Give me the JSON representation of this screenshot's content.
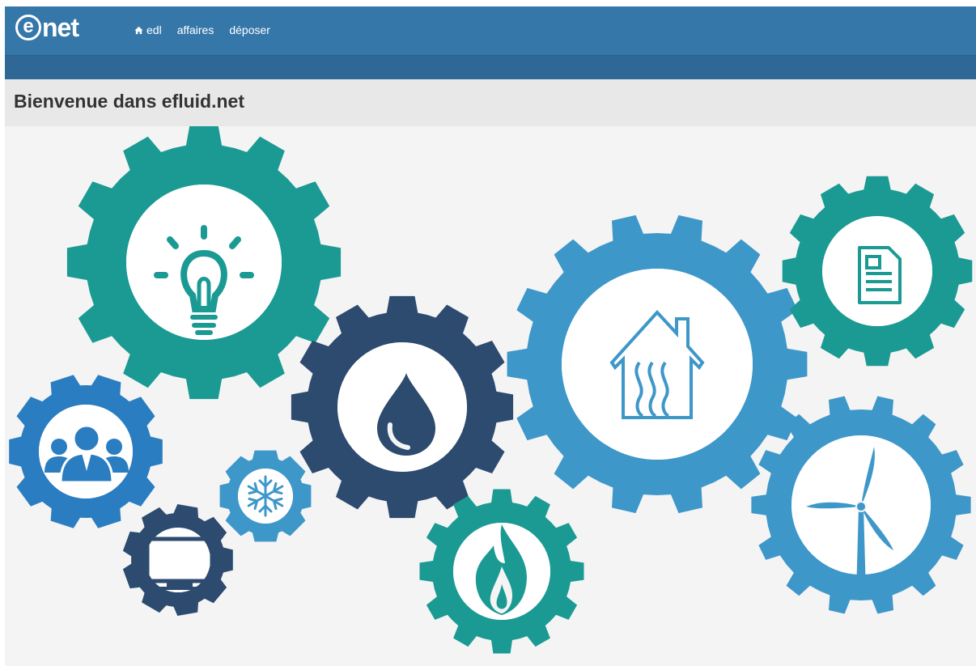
{
  "app": {
    "logo_letter": "e",
    "logo_word": "net"
  },
  "nav": {
    "items": [
      {
        "label": "edl",
        "icon": "home-icon"
      },
      {
        "label": "affaires"
      },
      {
        "label": "déposer"
      }
    ]
  },
  "page": {
    "title": "Bienvenue dans efluid.net"
  },
  "illustration": {
    "gears": [
      {
        "name": "lightbulb-gear",
        "icon": "lightbulb-icon",
        "color": "#1a9a93"
      },
      {
        "name": "water-drop-gear",
        "icon": "water-drop-icon",
        "color": "#2d4a6f"
      },
      {
        "name": "house-heating-gear",
        "icon": "house-heating-icon",
        "color": "#3e97c9"
      },
      {
        "name": "document-gear",
        "icon": "document-icon",
        "color": "#1a9a93"
      },
      {
        "name": "people-gear",
        "icon": "people-icon",
        "color": "#2a7dc0"
      },
      {
        "name": "snowflake-gear",
        "icon": "snowflake-icon",
        "color": "#3e97c9"
      },
      {
        "name": "monitor-gear",
        "icon": "monitor-icon",
        "color": "#2d4a6f"
      },
      {
        "name": "flame-gear",
        "icon": "flame-icon",
        "color": "#1a9a93"
      },
      {
        "name": "wind-turbine-gear",
        "icon": "wind-turbine-icon",
        "color": "#3e97c9"
      }
    ]
  },
  "colors": {
    "nav_bg": "#3677aa",
    "subbar_bg": "#2f6797",
    "header_bg": "#e8e8e8",
    "content_bg": "#f4f4f4"
  }
}
